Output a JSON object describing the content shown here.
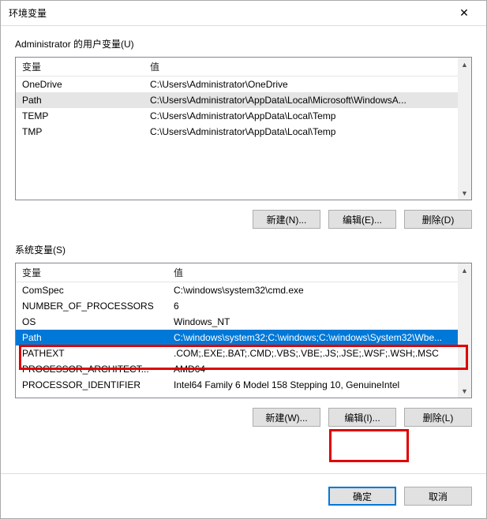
{
  "window": {
    "title": "环境变量",
    "close_icon": "✕"
  },
  "user_section": {
    "label": "Administrator 的用户变量(U)",
    "headers": {
      "name": "变量",
      "value": "值"
    },
    "rows": [
      {
        "name": "OneDrive",
        "value": "C:\\Users\\Administrator\\OneDrive"
      },
      {
        "name": "Path",
        "value": "C:\\Users\\Administrator\\AppData\\Local\\Microsoft\\WindowsA..."
      },
      {
        "name": "TEMP",
        "value": "C:\\Users\\Administrator\\AppData\\Local\\Temp"
      },
      {
        "name": "TMP",
        "value": "C:\\Users\\Administrator\\AppData\\Local\\Temp"
      }
    ],
    "selected_index": 1,
    "buttons": {
      "new": "新建(N)...",
      "edit": "编辑(E)...",
      "delete": "删除(D)"
    }
  },
  "sys_section": {
    "label": "系统变量(S)",
    "headers": {
      "name": "变量",
      "value": "值"
    },
    "rows": [
      {
        "name": "ComSpec",
        "value": "C:\\windows\\system32\\cmd.exe"
      },
      {
        "name": "NUMBER_OF_PROCESSORS",
        "value": "6"
      },
      {
        "name": "OS",
        "value": "Windows_NT"
      },
      {
        "name": "Path",
        "value": "C:\\windows\\system32;C:\\windows;C:\\windows\\System32\\Wbe..."
      },
      {
        "name": "PATHEXT",
        "value": ".COM;.EXE;.BAT;.CMD;.VBS;.VBE;.JS;.JSE;.WSF;.WSH;.MSC"
      },
      {
        "name": "PROCESSOR_ARCHITECT...",
        "value": "AMD64"
      },
      {
        "name": "PROCESSOR_IDENTIFIER",
        "value": "Intel64 Family 6 Model 158 Stepping 10, GenuineIntel"
      }
    ],
    "selected_index": 3,
    "buttons": {
      "new": "新建(W)...",
      "edit": "编辑(I)...",
      "delete": "删除(L)"
    }
  },
  "footer": {
    "ok": "确定",
    "cancel": "取消"
  },
  "scroll": {
    "up": "▲",
    "down": "▼"
  }
}
